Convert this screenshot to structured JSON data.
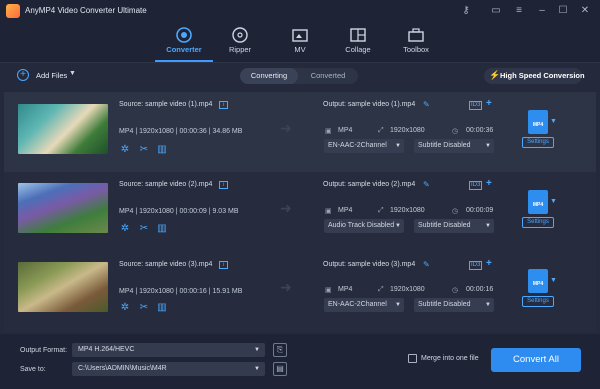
{
  "app": {
    "title": "AnyMP4 Video Converter Ultimate"
  },
  "nav": {
    "tabs": [
      {
        "label": "Converter"
      },
      {
        "label": "Ripper"
      },
      {
        "label": "MV"
      },
      {
        "label": "Collage"
      },
      {
        "label": "Toolbox"
      }
    ]
  },
  "actions": {
    "add_files": "Add Files",
    "converting": "Converting",
    "converted": "Converted",
    "high_speed": "High Speed Conversion"
  },
  "files": [
    {
      "source": "Source: sample video (1).mp4",
      "format": "MP4",
      "resolution": "1920x1080",
      "duration": "00:00:36",
      "size": "34.86 MB",
      "output": "Output: sample video (1).mp4",
      "out_format": "MP4",
      "out_resolution": "1920x1080",
      "out_duration": "00:00:36",
      "audio": "EN-AAC-2Channel",
      "subtitle": "Subtitle Disabled",
      "settings": "Settings",
      "fmt_badge": "MP4"
    },
    {
      "source": "Source: sample video (2).mp4",
      "format": "MP4",
      "resolution": "1920x1080",
      "duration": "00:00:09",
      "size": "9.03 MB",
      "output": "Output: sample video (2).mp4",
      "out_format": "MP4",
      "out_resolution": "1920x1080",
      "out_duration": "00:00:09",
      "audio": "Audio Track Disabled",
      "subtitle": "Subtitle Disabled",
      "settings": "Settings",
      "fmt_badge": "MP4"
    },
    {
      "source": "Source: sample video (3).mp4",
      "format": "MP4",
      "resolution": "1920x1080",
      "duration": "00:00:16",
      "size": "15.91 MB",
      "output": "Output: sample video (3).mp4",
      "out_format": "MP4",
      "out_resolution": "1920x1080",
      "out_duration": "00:00:16",
      "audio": "EN-AAC-2Channel",
      "subtitle": "Subtitle Disabled",
      "settings": "Settings",
      "fmt_badge": "MP4"
    }
  ],
  "bottom": {
    "output_format_label": "Output Format:",
    "output_format_value": "MP4 H.264/HEVC",
    "save_to_label": "Save to:",
    "save_to_value": "C:\\Users\\ADMIN\\Music\\M4R",
    "merge_label": "Merge into one file",
    "convert_all": "Convert All"
  },
  "colors": {
    "accent": "#2e8bf0",
    "background": "#242a3b",
    "titlebar": "#1e2435"
  }
}
